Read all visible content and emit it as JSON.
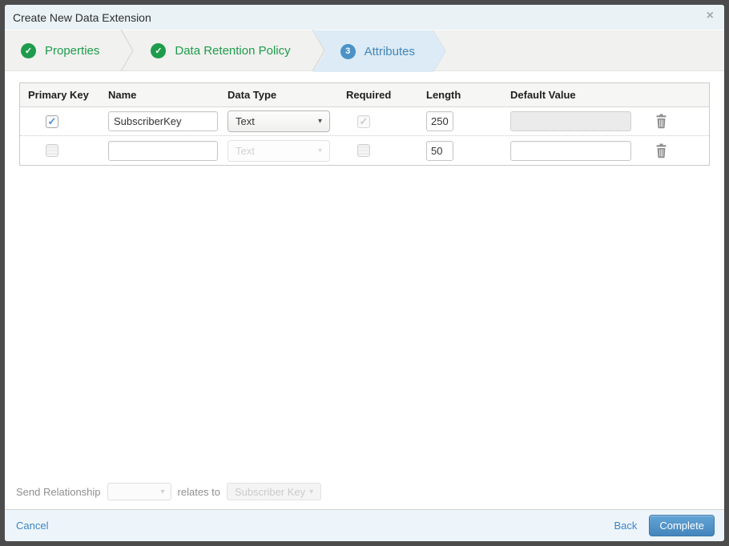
{
  "dialog": {
    "title": "Create New Data Extension"
  },
  "icons": {
    "close": "×",
    "check": "✓",
    "arrow_down": "▾",
    "trash": "trash-icon"
  },
  "wizard": {
    "steps": [
      {
        "label": "Properties",
        "status": "complete"
      },
      {
        "label": "Data Retention Policy",
        "status": "complete"
      },
      {
        "label": "Attributes",
        "status": "active",
        "number": "3"
      }
    ]
  },
  "table": {
    "columns": [
      "Primary Key",
      "Name",
      "Data Type",
      "Required",
      "Length",
      "Default Value"
    ],
    "rows": [
      {
        "primary_key": true,
        "name": "SubscriberKey",
        "data_type": "Text",
        "data_type_disabled": false,
        "required": true,
        "required_disabled": true,
        "length": "250",
        "default_value": "",
        "default_disabled": true
      },
      {
        "primary_key": false,
        "name": "",
        "data_type": "Text",
        "data_type_disabled": true,
        "required": false,
        "required_disabled": false,
        "length": "50",
        "default_value": "",
        "default_disabled": false
      }
    ]
  },
  "send_relationship": {
    "label": "Send Relationship",
    "relates_to_label": "relates to",
    "target_field": "Subscriber Key"
  },
  "footer": {
    "cancel_label": "Cancel",
    "back_label": "Back",
    "complete_label": "Complete"
  },
  "colors": {
    "step_complete_green": "#1e9c4c",
    "step_active_blue": "#4b92c7",
    "active_step_bg": "#dcebf5",
    "titlebar_bg": "#eaf2f6",
    "footer_bg": "#edf5fa",
    "link_blue": "#3d85c6",
    "complete_button_blue": "#4f93c8",
    "checkbox_check_blue": "#4a8fd3"
  }
}
